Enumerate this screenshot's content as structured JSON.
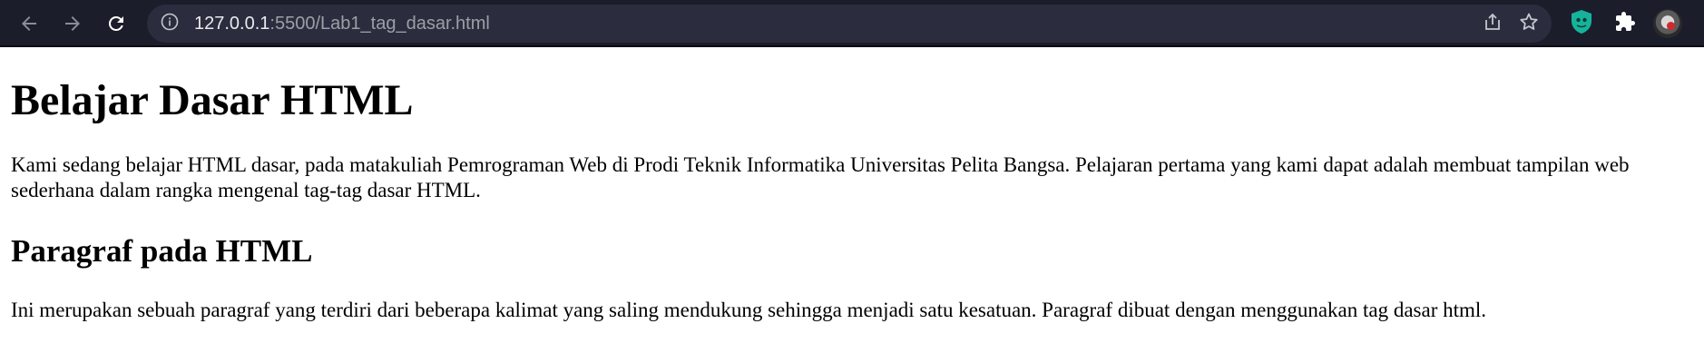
{
  "browser": {
    "url_host": "127.0.0.1",
    "url_path": ":5500/Lab1_tag_dasar.html",
    "icons": {
      "back": "back-arrow-icon",
      "forward": "forward-arrow-icon",
      "reload": "reload-icon",
      "site_info": "info-icon",
      "share": "share-icon",
      "bookmark": "star-icon",
      "extension_shield": "shield-extension-icon",
      "extensions": "puzzle-icon",
      "profile": "avatar"
    },
    "colors": {
      "toolbar_bg": "#1b1d2b",
      "omnibox_bg": "#2b2d3e",
      "shield_accent": "#16b39c"
    }
  },
  "page": {
    "heading": "Belajar Dasar HTML",
    "intro_paragraph": "Kami sedang belajar HTML dasar, pada matakuliah Pemrograman Web di Prodi Teknik Informatika Universitas Pelita Bangsa. Pelajaran pertama yang kami dapat adalah membuat tampilan web sederhana dalam rangka mengenal tag-tag dasar HTML.",
    "subheading": "Paragraf pada HTML",
    "body_paragraph": "Ini merupakan sebuah paragraf yang terdiri dari beberapa kalimat yang saling mendukung sehingga menjadi satu kesatuan. Paragraf dibuat dengan menggunakan tag dasar html."
  }
}
